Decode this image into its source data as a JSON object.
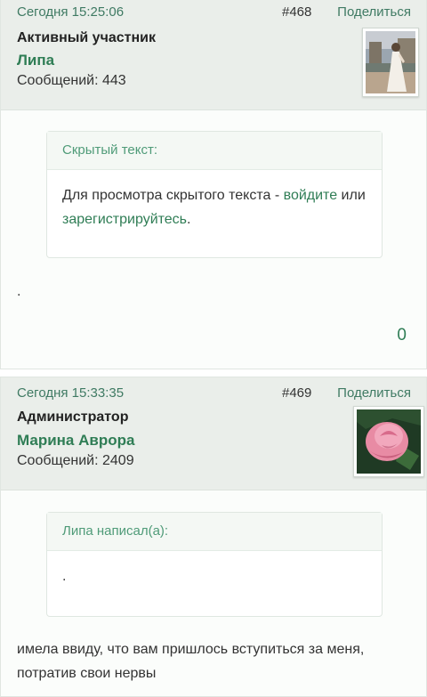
{
  "posts": [
    {
      "date": "Сегодня 15:25:06",
      "number": "#468",
      "share_label": "Поделиться",
      "role": "Активный участник",
      "author": "Липа",
      "messages": "Сообщений: 443",
      "avatar_icon": "bride-photo-avatar",
      "quote": {
        "title": "Скрытый текст:",
        "text_before": "Для просмотра скрытого текста - ",
        "login_link": "войдите",
        "text_middle": " или ",
        "register_link": "зарегистрируйтесь",
        "text_after": "."
      },
      "body_text": ".",
      "reaction_count": "0"
    },
    {
      "date": "Сегодня 15:33:35",
      "number": "#469",
      "share_label": "Поделиться",
      "role": "Администратор",
      "author": "Марина Аврора",
      "messages": "Сообщений: 2409",
      "avatar_icon": "pink-rose-avatar",
      "quote": {
        "title": "Липа написал(а):",
        "text": "."
      },
      "body_text": "имела ввиду, что вам пришлось вступиться за меня, потратив свои нервы"
    }
  ],
  "colors": {
    "accent_green": "#2f7d55",
    "header_bg": "#eaeeea",
    "link_green": "#3f7a63"
  }
}
